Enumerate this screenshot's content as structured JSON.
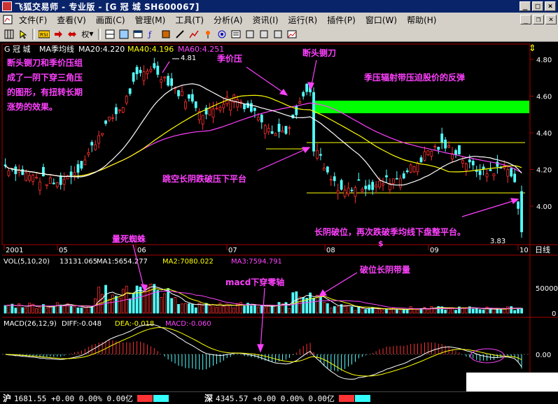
{
  "window": {
    "title": "飞狐交易师 - 专业版 - [G 冠  城 SH600067]",
    "min_label": "_",
    "max_label": "□",
    "close_label": "×",
    "mdi_min": "_",
    "mdi_restore": "❐",
    "mdi_close": "×"
  },
  "menu": [
    "文件(F)",
    "查看(V)",
    "画面(C)",
    "管理(M)",
    "工具(T)",
    "分析(A)",
    "资讯(I)",
    "运行(R)",
    "插件(P)",
    "窗口(W)",
    "帮助(H)"
  ],
  "toolbar": {
    "icons": [
      "chart-icon",
      "grid-icon",
      "cursor-icon",
      "rsi-icon",
      "arrow-right-icon",
      "arrow-left-right-icon",
      "weight-icon",
      "split-icon",
      "layout-icon",
      "window-icon",
      "formula-icon",
      "book-icon",
      "edit-icon",
      "draw-icon",
      "pin-icon",
      "target-icon",
      "news-icon",
      "box-icon",
      "box-icon",
      "box-icon",
      "box-icon",
      "image-icon"
    ],
    "weight_label": "权"
  },
  "price_panel": {
    "stock": "G 冠  城",
    "indicator": "MA季均线",
    "ma20": "MA20:4.220",
    "ma40": "MA40:4.196",
    "ma60": "MA60:4.251",
    "high_label": "4.81",
    "low_label": "3.83",
    "price_ticks": [
      "4.80",
      "4.60",
      "4.40",
      "4.20",
      "4.00"
    ],
    "date_ticks": [
      "2001",
      "05",
      "06",
      "07",
      "08",
      "09",
      "10"
    ],
    "period": "日线",
    "annotations": {
      "note_left": "断头铡刀和季价压组成了一阴下穿三角压的图形，有扭转长期涨势的效果。",
      "note_left_lines": [
        "断头铡刀和季价压组",
        "成了一阴下穿三角压",
        "的图形，有扭转长期",
        "涨势的效果。"
      ],
      "season_pressure": "季价压",
      "guillotine": "断头铡刀",
      "rebound": "季压辐射带压迫股价的反弹",
      "gap_break": "跳空长阴跌破压下平台",
      "breakdown": "长阴破位，再次跌破季均线下盘整平台。",
      "dollar": "$"
    }
  },
  "volume_panel": {
    "label": "VOL(5,10,20)",
    "vol": "13131.065",
    "ma1": "MA1:5654.277",
    "ma2": "MA2:7080.022",
    "ma3": "MA3:7594.791",
    "tick": "50000",
    "tick0": "0",
    "annotations": {
      "spider": "量死蜘蛛",
      "macd_cross": "macd下穿零轴",
      "breakdown_volume": "破位长阴带量"
    }
  },
  "macd_panel": {
    "label": "MACD(26,12,9)",
    "diff": "DIFF:-0.048",
    "dea": "DEA:-0.018",
    "macd": "MACD:-0.060",
    "tick": "0.00"
  },
  "statusbar": {
    "sh_symbol": "沪",
    "sh_value": "1681.55 +0.00 0.00% 0.00亿",
    "sz_symbol": "深",
    "sz_value": "4345.57 +0.00 0.00% 0.00亿"
  },
  "colors": {
    "up": "#ff3030",
    "down": "#54ffff",
    "ma20": "#ffffff",
    "ma40": "#ffff00",
    "ma60": "#ff40ff",
    "annotation": "#ff40ff",
    "band": "#00ff00"
  }
}
